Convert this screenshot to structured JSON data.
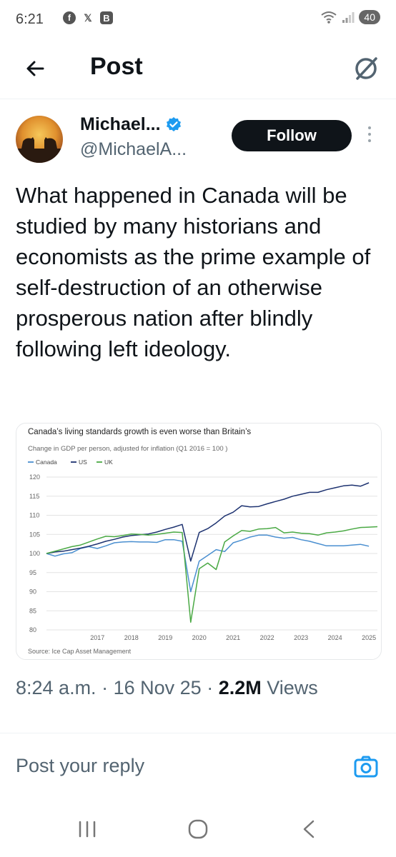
{
  "status_bar": {
    "time": "6:21",
    "battery": "40",
    "apps": [
      "f",
      "𝕏",
      "B"
    ]
  },
  "header": {
    "title": "Post"
  },
  "post": {
    "author_name": "Michael...",
    "handle": "@MichaelA...",
    "follow_label": "Follow",
    "text": "What happened in Canada will be studied by many historians and economists as the prime example of self-destruction of an otherwise prosperous nation after blindly following left ideology.",
    "time": "8:24 a.m.",
    "date": "16 Nov 25",
    "views_count": "2.2M",
    "views_label": "Views",
    "dot": "·"
  },
  "reply": {
    "placeholder": "Post your reply"
  },
  "colors": {
    "canada": "#4a8fd0",
    "us": "#1d3270",
    "uk": "#4aa944",
    "follow_bg": "#0f1419",
    "accent": "#1d9bf0"
  },
  "icons": {
    "back": "arrow-left-icon",
    "grok": "grok-icon",
    "verified": "verified-badge-icon",
    "more": "more-vertical-icon",
    "camera": "camera-icon"
  },
  "chart_data": {
    "type": "line",
    "title": "Canada’s living standards growth is even worse than Britain’s",
    "subtitle": "Change in GDP per person, adjusted for inflation (Q1 2016 = 100 )",
    "source": "Source: Ice Cap Asset Management",
    "ylim": [
      80,
      120
    ],
    "xlim": [
      2016.0,
      2025.75
    ],
    "yticks": [
      "120",
      "115",
      "110",
      "105",
      "100",
      "95",
      "90",
      "85",
      "80"
    ],
    "xticks": [
      "2017",
      "2018",
      "2019",
      "2020",
      "2021",
      "2022",
      "2023",
      "2024",
      "2025"
    ],
    "legend_position": "top-left",
    "series": [
      {
        "name": "Canada",
        "color": "#4a8fd0",
        "x": [
          2016.0,
          2016.25,
          2016.5,
          2016.75,
          2017.0,
          2017.25,
          2017.5,
          2017.75,
          2018.0,
          2018.25,
          2018.5,
          2018.75,
          2019.0,
          2019.25,
          2019.5,
          2019.75,
          2020.0,
          2020.25,
          2020.5,
          2020.75,
          2021.0,
          2021.25,
          2021.5,
          2021.75,
          2022.0,
          2022.25,
          2022.5,
          2022.75,
          2023.0,
          2023.25,
          2023.5,
          2023.75,
          2024.0,
          2024.25,
          2024.5,
          2024.75,
          2025.0,
          2025.25,
          2025.5
        ],
        "y": [
          100,
          99.3,
          99.9,
          100.2,
          101.3,
          101.8,
          101.3,
          102.0,
          102.8,
          103.0,
          103.1,
          103.0,
          103.0,
          102.9,
          103.6,
          103.6,
          103.2,
          90.0,
          98.0,
          99.5,
          101.0,
          100.5,
          102.8,
          103.5,
          104.3,
          104.8,
          104.8,
          104.3,
          104.0,
          104.2,
          103.6,
          103.2,
          102.6,
          102.0,
          102.0,
          102.0,
          102.2,
          102.4,
          101.9
        ]
      },
      {
        "name": "US",
        "color": "#1d3270",
        "x": [
          2016.0,
          2016.25,
          2016.5,
          2016.75,
          2017.0,
          2017.25,
          2017.5,
          2017.75,
          2018.0,
          2018.25,
          2018.5,
          2018.75,
          2019.0,
          2019.25,
          2019.5,
          2019.75,
          2020.0,
          2020.25,
          2020.5,
          2020.75,
          2021.0,
          2021.25,
          2021.5,
          2021.75,
          2022.0,
          2022.25,
          2022.5,
          2022.75,
          2023.0,
          2023.25,
          2023.5,
          2023.75,
          2024.0,
          2024.25,
          2024.5,
          2024.75,
          2025.0,
          2025.25,
          2025.5
        ],
        "y": [
          100,
          100.4,
          100.6,
          101.0,
          101.4,
          101.9,
          102.5,
          103.2,
          103.7,
          104.3,
          104.7,
          104.9,
          105.1,
          105.6,
          106.3,
          106.9,
          107.6,
          98.0,
          105.5,
          106.5,
          108.0,
          109.8,
          110.8,
          112.5,
          112.2,
          112.3,
          113.0,
          113.6,
          114.2,
          115.0,
          115.5,
          116.0,
          116.0,
          116.7,
          117.2,
          117.7,
          117.9,
          117.6,
          118.5
        ]
      },
      {
        "name": "UK",
        "color": "#4aa944",
        "x": [
          2016.0,
          2016.25,
          2016.5,
          2016.75,
          2017.0,
          2017.25,
          2017.5,
          2017.75,
          2018.0,
          2018.25,
          2018.5,
          2018.75,
          2019.0,
          2019.25,
          2019.5,
          2019.75,
          2020.0,
          2020.25,
          2020.5,
          2020.75,
          2021.0,
          2021.25,
          2021.5,
          2021.75,
          2022.0,
          2022.25,
          2022.5,
          2022.75,
          2023.0,
          2023.25,
          2023.5,
          2023.75,
          2024.0,
          2024.25,
          2024.5,
          2024.75,
          2025.0,
          2025.25,
          2025.5,
          2025.75
        ],
        "y": [
          100,
          100.6,
          101.2,
          101.8,
          102.2,
          103.0,
          103.8,
          104.5,
          104.4,
          104.7,
          105.1,
          105.0,
          104.8,
          105.0,
          105.3,
          105.6,
          105.5,
          82.0,
          96.0,
          97.5,
          95.8,
          103.0,
          104.6,
          106.0,
          105.8,
          106.4,
          106.5,
          106.8,
          105.4,
          105.6,
          105.3,
          105.2,
          104.8,
          105.4,
          105.6,
          105.9,
          106.4,
          106.8,
          106.9,
          107.0
        ]
      }
    ]
  }
}
